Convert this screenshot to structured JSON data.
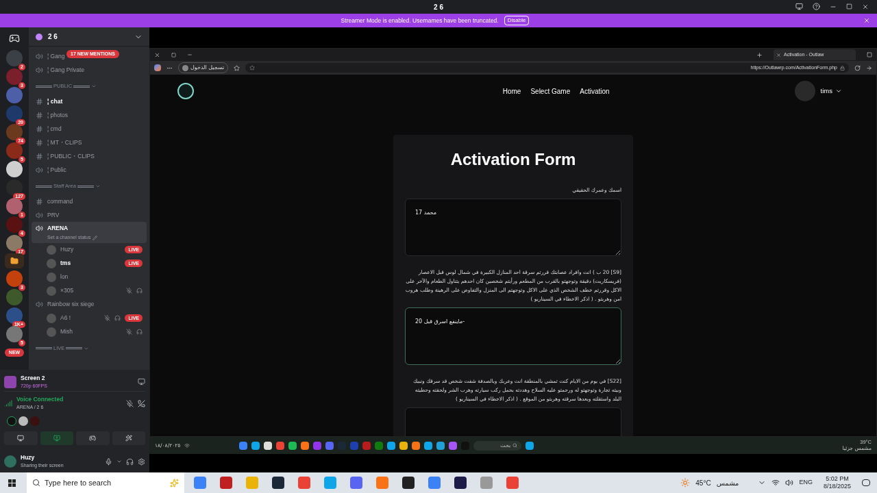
{
  "titlebar": {
    "title": "2 6"
  },
  "banner": {
    "text": "Streamer Mode is enabled. Usernames have been truncated.",
    "button": "Disable"
  },
  "servers": [
    {
      "kind": "server",
      "badge": "2"
    },
    {
      "kind": "server",
      "badge": "3"
    },
    {
      "kind": "server"
    },
    {
      "kind": "server",
      "badge": "20"
    },
    {
      "kind": "server",
      "badge": "74"
    },
    {
      "kind": "server",
      "badge": "5"
    },
    {
      "kind": "server"
    },
    {
      "kind": "server",
      "badge": "127"
    },
    {
      "kind": "server",
      "badge": "1"
    },
    {
      "kind": "server",
      "badge": "4"
    },
    {
      "kind": "server",
      "badge": "17"
    },
    {
      "kind": "folder"
    },
    {
      "kind": "server",
      "badge": "3"
    },
    {
      "kind": "server"
    },
    {
      "kind": "server",
      "badge": "1K+"
    },
    {
      "kind": "server",
      "badge": "5"
    }
  ],
  "new_pill": "NEW",
  "server_header": {
    "name": "2 6"
  },
  "mentions_pill": "17 NEW MENTIONS",
  "channels": [
    {
      "kind": "voice",
      "name": "¦ Gang"
    },
    {
      "kind": "voice",
      "name": "¦ Gang Private"
    },
    {
      "kind": "category",
      "name": "PUBLIC"
    },
    {
      "kind": "text",
      "name": "¦ chat",
      "unread": true
    },
    {
      "kind": "text",
      "name": "¦ photos",
      "unread": false
    },
    {
      "kind": "text",
      "name": "¦ cmd",
      "unread": false
    },
    {
      "kind": "text",
      "name": "¦ MT・CLIPS",
      "unread": false
    },
    {
      "kind": "text",
      "name": "¦ PUBLIC・CLIPS",
      "unread": false
    },
    {
      "kind": "voice",
      "name": "¦ Public"
    },
    {
      "kind": "category",
      "name": "Staff Area"
    },
    {
      "kind": "text",
      "name": "command",
      "unread": false
    },
    {
      "kind": "voice",
      "name": "PRV"
    },
    {
      "kind": "voice",
      "name": "ARENA",
      "selected": true,
      "status": "Set a channel status",
      "members": [
        {
          "name": "Huzy",
          "badge": "LIVE",
          "muted": false,
          "bold": false
        },
        {
          "name": "tms",
          "badge": "LIVE",
          "muted": false,
          "bold": true
        },
        {
          "name": "lon",
          "muted": false,
          "bold": false
        },
        {
          "name": "×305",
          "muted": true,
          "bold": false
        }
      ]
    },
    {
      "kind": "voice",
      "name": "Rainbow six siege",
      "selected": false,
      "members": [
        {
          "name": "A6 !",
          "badge": "LIVE",
          "muted": true,
          "bold": false
        },
        {
          "name": "Mish",
          "muted": true,
          "bold": false
        }
      ]
    },
    {
      "kind": "category",
      "name": "LIVE"
    }
  ],
  "stream": {
    "title": "Screen 2",
    "quality": "720p 60FPS"
  },
  "voice": {
    "status": "Voice Connected",
    "channel": "ARENA / 2 6"
  },
  "user": {
    "name": "Huzy",
    "activity": "Sharing their screen"
  },
  "browser": {
    "tab": "Activation - Outlaw",
    "profile": "تسجيل الدخول",
    "url": "https://Outlawrp.com/ActivationForm.php"
  },
  "site": {
    "nav": [
      {
        "label": "Home"
      },
      {
        "label": "Select Game"
      },
      {
        "label": "Activation"
      }
    ],
    "user": "tims"
  },
  "form": {
    "title": "Activation Form",
    "fields": [
      {
        "label": "اسمك وعمرك الحقيقي",
        "value": "محمد 17",
        "focused": false
      },
      {
        "label": "[S9] 20 ب ) انت وافراد عصابتك قررتم سرقة احد المنازل الكبيرة في شمال لوس قبل الاعصار (فريسكاريت) دقيقة وتوجهتو بالقرب من المطعم ورأيتم شخصين كان احدهم يتناول الطعام والآخر على الاكل وقررتم خطف الشخص الذي على الاكل وتوجهتم الى المنزل والتفاوض على الرهينة وطلب هروب امن وهربتو . ( اذكر الاخطاء في السيناريو )",
        "value": "ماينفع اسرق قبل 20-",
        "focused": true
      },
      {
        "label": "[S22] في يوم من الايام كنت تمشي بالمنطقة انت وعربك وبالصدفة شفت شخص قد سرقك ونبيك وبيته تجارة وتوجهتو له ورحمتو عليه السلاح وهددته بحمل ركب سيارته وهرب الشر ولحقته وحطيته البلد واستقلته وبعدها سرقته وهربتو من الموقع . ( اذكر الاخطاء في السيناريو )",
        "focused": false
      }
    ]
  },
  "shared_taskbar": {
    "date": "١٨/٠٨/٢٠٢٥",
    "search": "بحث",
    "temperature": "39°C",
    "weather": "مشمس جزئيا"
  },
  "taskbar": {
    "search": "Type here to search",
    "temperature": "45°C",
    "weather": "مشمس",
    "language": "ENG",
    "time": "5:02 PM",
    "date": "8/18/2025"
  }
}
